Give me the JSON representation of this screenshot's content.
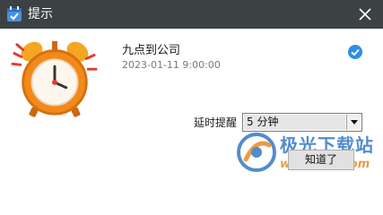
{
  "window": {
    "title": "提示",
    "app_icon": "calendar-check-icon",
    "close_icon": "close-icon"
  },
  "reminder": {
    "title": "九点到公司",
    "datetime": "2023-01-11 9:00:00",
    "status_icon": "checkmark-circle-icon",
    "illustration": "alarm-clock-icon"
  },
  "snooze": {
    "label": "延时提醒",
    "selected": "5 分钟"
  },
  "actions": {
    "ok_label": "知道了"
  },
  "watermark": {
    "name": "极光下载站",
    "url": "www.xz7.com"
  },
  "colors": {
    "titlebar": "#3c4143",
    "accent_blue": "#2d8ee6",
    "clock_orange": "#f28a1a"
  }
}
